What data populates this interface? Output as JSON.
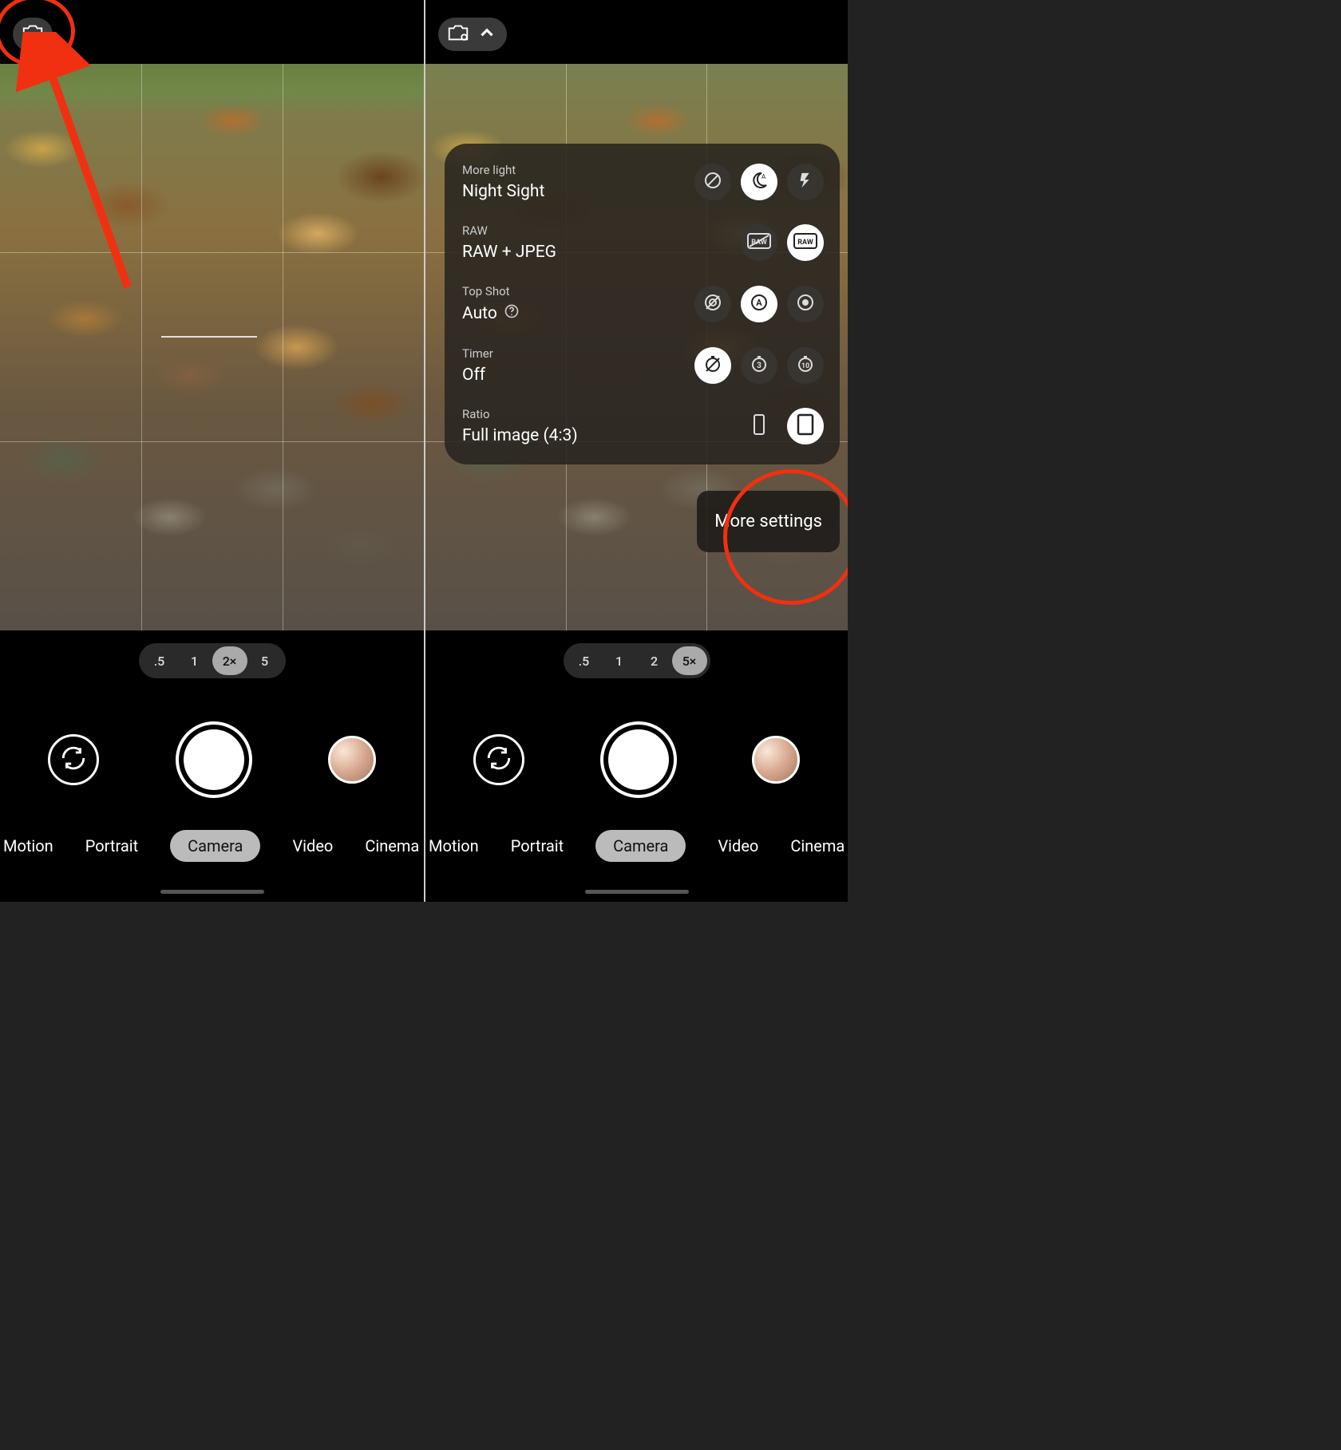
{
  "left": {
    "zoom": {
      "options": [
        ".5",
        "1",
        "2×",
        "5"
      ],
      "selectedIndex": 2
    },
    "modes": [
      "Motion",
      "Portrait",
      "Camera",
      "Video",
      "Cinema"
    ],
    "selectedModeIndex": 2
  },
  "right": {
    "zoom": {
      "options": [
        ".5",
        "1",
        "2",
        "5×"
      ],
      "selectedIndex": 3
    },
    "modes": [
      "Motion",
      "Portrait",
      "Camera",
      "Video",
      "Cinema"
    ],
    "selectedModeIndex": 2,
    "panel": {
      "moreLight": {
        "label": "More light",
        "value": "Night Sight",
        "options": [
          "off",
          "auto",
          "flash"
        ],
        "selectedIndex": 1
      },
      "raw": {
        "label": "RAW",
        "value": "RAW + JPEG",
        "options": [
          "raw-off",
          "raw-on"
        ],
        "selectedIndex": 1
      },
      "topShot": {
        "label": "Top Shot",
        "value": "Auto",
        "options": [
          "off",
          "auto",
          "on"
        ],
        "selectedIndex": 1
      },
      "timer": {
        "label": "Timer",
        "value": "Off",
        "options": [
          "off",
          "3",
          "10"
        ],
        "selectedIndex": 0
      },
      "ratio": {
        "label": "Ratio",
        "value": "Full image (4:3)",
        "options": [
          "wide",
          "full"
        ],
        "selectedIndex": 1
      },
      "moreSettings": "More settings"
    }
  }
}
